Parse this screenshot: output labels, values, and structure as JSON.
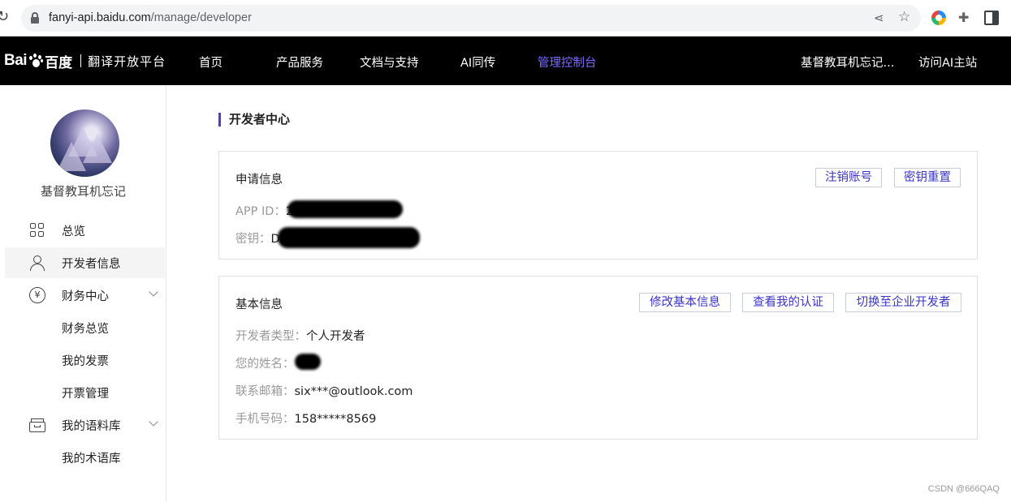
{
  "browser": {
    "url_host": "fanyi-api.baidu.com",
    "url_path": "/manage/developer"
  },
  "nav": {
    "logo_text": "Bai",
    "logo_cn": "百度",
    "platform": "翻译开放平台",
    "items": [
      "首页",
      "产品服务",
      "文档与支持",
      "AI同传",
      "管理控制台"
    ],
    "active_item": "管理控制台",
    "user": "基督教耳机忘记...",
    "visit_ai": "访问AI主站"
  },
  "sidebar": {
    "username": "基督教耳机忘记",
    "items": [
      {
        "label": "总览",
        "icon": "grid-icon"
      },
      {
        "label": "开发者信息",
        "icon": "user-icon"
      },
      {
        "label": "财务中心",
        "icon": "yen-icon"
      },
      {
        "label": "财务总览"
      },
      {
        "label": "我的发票"
      },
      {
        "label": "开票管理"
      },
      {
        "label": "我的语料库",
        "icon": "box-icon"
      },
      {
        "label": "我的术语库"
      }
    ]
  },
  "main": {
    "title": "开发者中心",
    "app_card": {
      "title": "申请信息",
      "btn_cancel": "注销账号",
      "btn_reset": "密钥重置",
      "appid_label": "APP ID：",
      "appid_value": "2",
      "key_label": "密钥：",
      "key_value": "D"
    },
    "basic_card": {
      "title": "基本信息",
      "btn_edit": "修改基本信息",
      "btn_cert": "查看我的认证",
      "btn_switch": "切换至企业开发者",
      "type_label": "开发者类型：",
      "type_value": "个人开发者",
      "name_label": "您的姓名：",
      "name_value": "",
      "email_label": "联系邮箱：",
      "email_value": "six***@outlook.com",
      "phone_label": "手机号码：",
      "phone_value": "158*****8569"
    }
  },
  "watermark": "CSDN @666QAQ",
  "colors": {
    "accent": "#4e3bd6",
    "nav_bg": "#000000",
    "active_nav": "#7b6bff"
  }
}
